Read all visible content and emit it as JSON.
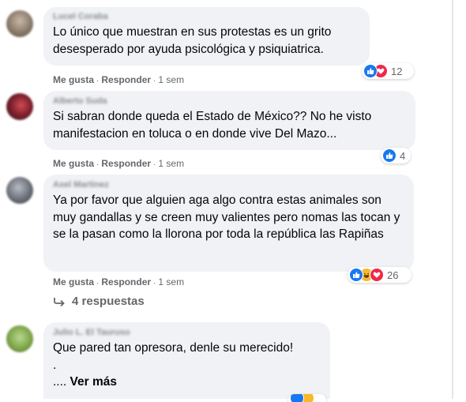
{
  "comments": [
    {
      "author": "Lucel Coraba",
      "text": "Lo único que muestran en sus protestas es un grito desesperado por ayuda psicológica y psiquiatrica.",
      "like": "Me gusta",
      "reply": "Responder",
      "time": "1 sem",
      "reaction_count": "12",
      "reaction_icons": [
        "like-icon",
        "love-icon"
      ],
      "avatar_color": "#8a7a6a"
    },
    {
      "author": "Alberto Suda",
      "text": "Si sabran donde queda el Estado de México?? No he visto manifestacion en toluca o en donde vive Del Mazo...",
      "like": "Me gusta",
      "reply": "Responder",
      "time": "1 sem",
      "reaction_count": "4",
      "reaction_icons": [
        "like-icon"
      ],
      "avatar_color": "#7a1f2b"
    },
    {
      "author": "Axel Martinez",
      "text": "Ya por favor que alguien aga algo contra estas animales son muy gandallas y se creen muy valientes pero nomas las tocan y se la pasan como la llorona por toda la república las Rapiñas",
      "like": "Me gusta",
      "reply": "Responder",
      "time": "1 sem",
      "reaction_count": "26",
      "reaction_icons": [
        "like-icon",
        "haha-icon",
        "love-icon"
      ],
      "avatar_color": "#6a6f78",
      "replies_label": "4 respuestas"
    },
    {
      "author": "Julio L. El Tauruso",
      "text_line1": "Que pared tan opresora, denle su merecido!",
      "text_line2": ".",
      "text_line3": "....",
      "see_more": "Ver más",
      "avatar_color": "#7fa64a"
    }
  ],
  "colors": {
    "bubble_bg": "#f0f2f5",
    "meta_text": "#65676b",
    "like_blue": "#1877f2",
    "love_red": "#f02849",
    "haha_yellow": "#f7b928"
  }
}
